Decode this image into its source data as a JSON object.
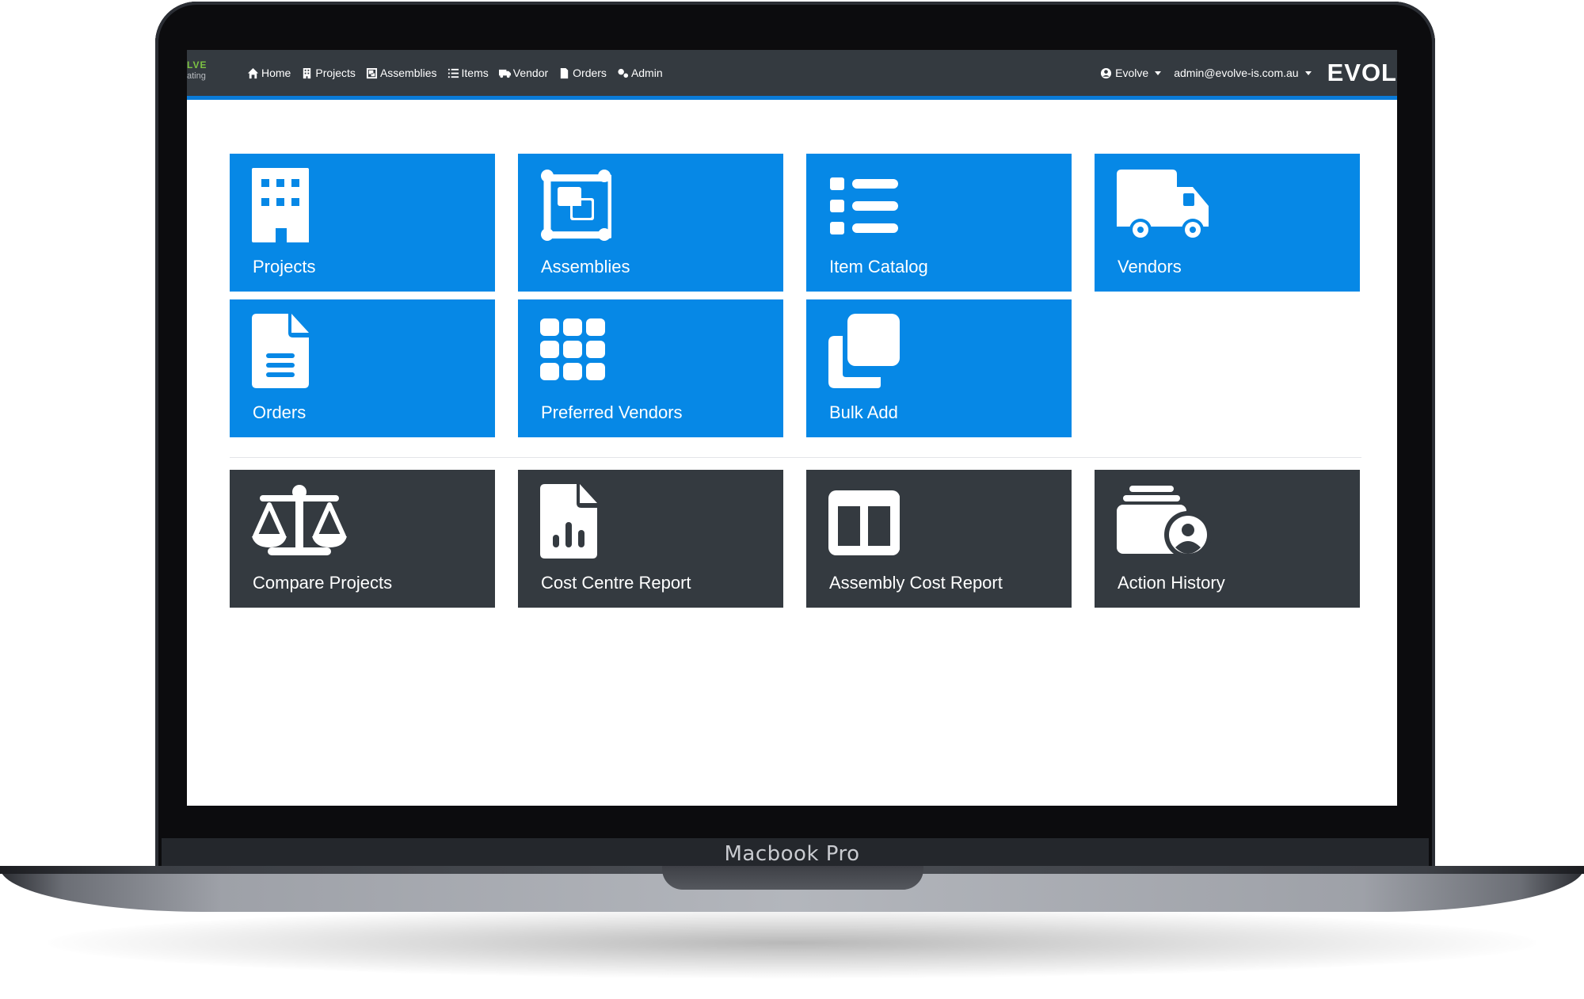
{
  "device": {
    "label": "Macbook Pro"
  },
  "navbar": {
    "logo_text": "LVE",
    "logo_subtext": "ating",
    "links": [
      {
        "label": "Home",
        "icon": "home-icon"
      },
      {
        "label": "Projects",
        "icon": "building-icon"
      },
      {
        "label": "Assemblies",
        "icon": "object-group-icon"
      },
      {
        "label": "Items",
        "icon": "list-icon"
      },
      {
        "label": "Vendor",
        "icon": "truck-icon"
      },
      {
        "label": "Orders",
        "icon": "file-icon"
      },
      {
        "label": "Admin",
        "icon": "cogs-icon"
      }
    ],
    "tenant": "Evolve",
    "user_email": "admin@evolve-is.com.au",
    "brand": "EVOL"
  },
  "tiles_primary": [
    {
      "label": "Projects",
      "icon": "building-icon"
    },
    {
      "label": "Assemblies",
      "icon": "object-group-icon"
    },
    {
      "label": "Item Catalog",
      "icon": "list-icon"
    },
    {
      "label": "Vendors",
      "icon": "truck-icon"
    },
    {
      "label": "Orders",
      "icon": "file-lines-icon"
    },
    {
      "label": "Preferred Vendors",
      "icon": "grid-icon"
    },
    {
      "label": "Bulk Add",
      "icon": "clone-icon"
    }
  ],
  "tiles_reports": [
    {
      "label": "Compare Projects",
      "icon": "balance-scale-icon"
    },
    {
      "label": "Cost Centre Report",
      "icon": "file-chart-icon"
    },
    {
      "label": "Assembly Cost Report",
      "icon": "columns-icon"
    },
    {
      "label": "Action History",
      "icon": "user-history-icon"
    }
  ],
  "colors": {
    "primary_tile": "#0688e6",
    "report_tile": "#343a40",
    "navbar": "#343a40",
    "accent": "#0a7bd8"
  }
}
